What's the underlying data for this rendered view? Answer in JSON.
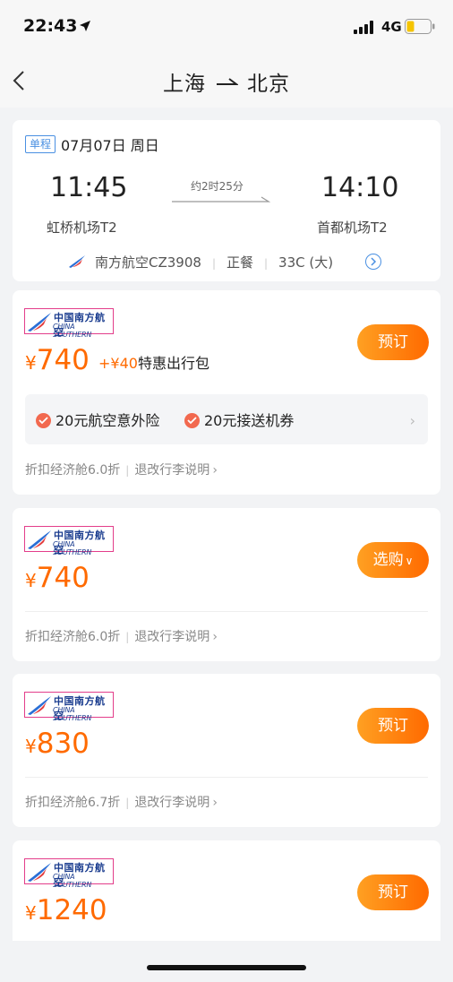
{
  "status_bar": {
    "time": "22:43",
    "network": "4G"
  },
  "nav": {
    "from": "上海",
    "to": "北京"
  },
  "flight": {
    "trip_type": "单程",
    "date": "07月07日 周日",
    "dep_time": "11:45",
    "arr_time": "14:10",
    "duration": "约2时25分",
    "dep_airport": "虹桥机场T2",
    "arr_airport": "首都机场T2",
    "airline_flight": "南方航空CZ3908",
    "meal": "正餐",
    "aircraft": "33C (大)"
  },
  "logo": {
    "cn": "中国南方航空",
    "en": "CHINA SOUTHERN"
  },
  "offers": [
    {
      "currency": "¥",
      "price": "740",
      "promo_plus": "+¥40",
      "promo_text": "特惠出行包",
      "button": "预订",
      "benefit1": "20元航空意外险",
      "benefit2": "20元接送机券",
      "cabin": "折扣经济舱6.0折",
      "rules": "退改行李说明"
    },
    {
      "currency": "¥",
      "price": "740",
      "button": "选购",
      "cabin": "折扣经济舱6.0折",
      "rules": "退改行李说明"
    },
    {
      "currency": "¥",
      "price": "830",
      "button": "预订",
      "cabin": "折扣经济舱6.7折",
      "rules": "退改行李说明"
    },
    {
      "currency": "¥",
      "price": "1240",
      "button": "预订"
    }
  ],
  "colors": {
    "accent": "#ff6a00",
    "link": "#4a90e2",
    "check": "#f2694f"
  }
}
